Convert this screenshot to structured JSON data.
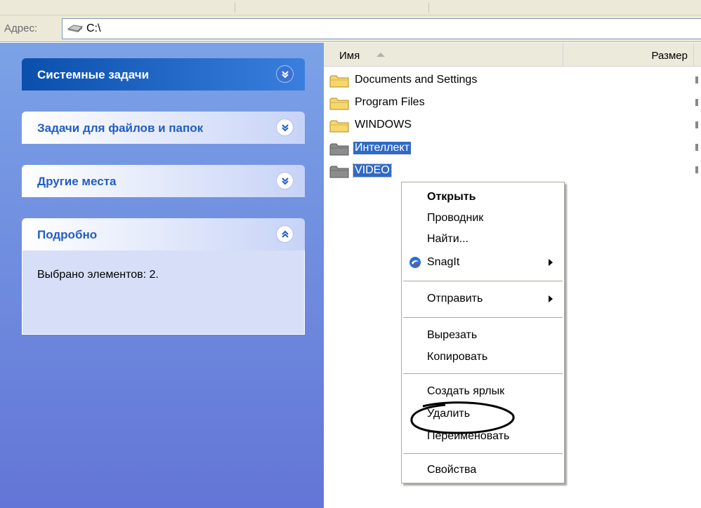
{
  "address_bar": {
    "label": "Адрес:",
    "value": "C:\\"
  },
  "task_pane": {
    "sections": [
      {
        "title": "Системные задачи",
        "expanded": false
      },
      {
        "title": "Задачи для файлов и папок",
        "expanded": false
      },
      {
        "title": "Другие места",
        "expanded": false
      },
      {
        "title": "Подробно",
        "expanded": true,
        "body": "Выбрано элементов: 2."
      }
    ]
  },
  "file_list": {
    "columns": [
      "Имя",
      "Размер"
    ],
    "sort_column": "Имя",
    "items": [
      {
        "name": "Documents and Settings",
        "selected": false
      },
      {
        "name": "Program Files",
        "selected": false
      },
      {
        "name": "WINDOWS",
        "selected": false
      },
      {
        "name": "Интеллект",
        "selected": true
      },
      {
        "name": "VIDEO",
        "selected": true
      }
    ]
  },
  "context_menu": {
    "items": [
      {
        "label": "Открыть",
        "bold": true
      },
      {
        "label": "Проводник"
      },
      {
        "label": "Найти..."
      },
      {
        "label": "SnagIt",
        "submenu": true,
        "icon": "snagit-icon"
      },
      {
        "label": "Отправить",
        "submenu": true
      },
      {
        "label": "Вырезать"
      },
      {
        "label": "Копировать"
      },
      {
        "label": "Создать ярлык"
      },
      {
        "label": "Удалить",
        "highlighted_by_annotation": true
      },
      {
        "label": "Переименовать"
      },
      {
        "label": "Свойства"
      }
    ]
  },
  "colors": {
    "task_pane_top": "#7ba2e7",
    "task_pane_bottom": "#6375d6",
    "selection": "#316ac5",
    "task_title": "#215dc6"
  }
}
